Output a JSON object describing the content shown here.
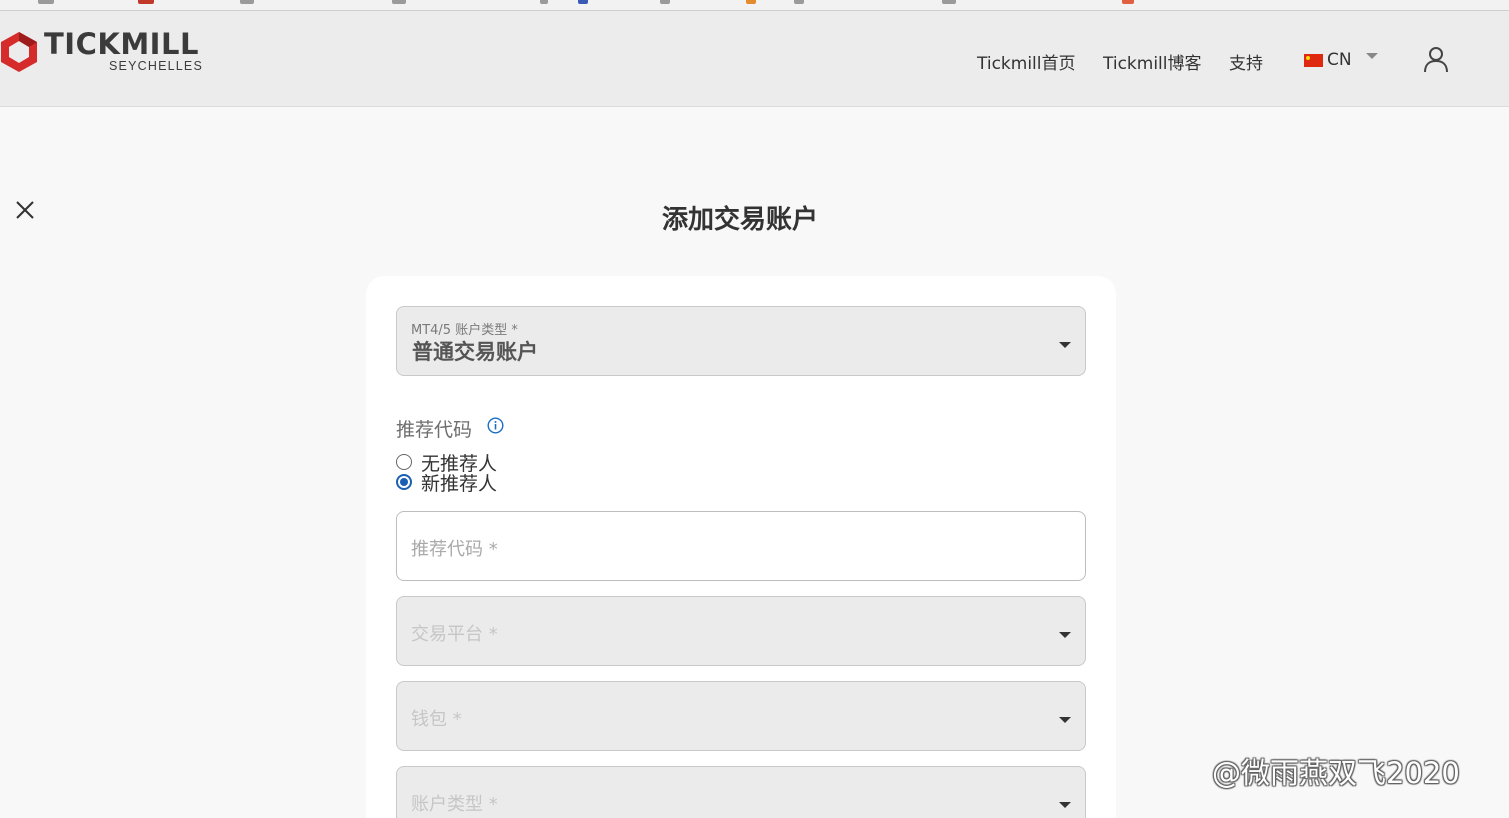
{
  "brand": {
    "name": "TICKMILL",
    "region": "SEYCHELLES",
    "color": "#d62b2b"
  },
  "nav": {
    "items": [
      {
        "label": "Tickmill首页"
      },
      {
        "label": "Tickmill博客"
      },
      {
        "label": "支持"
      }
    ],
    "language": {
      "label": "CN",
      "flag": "china-flag-icon"
    },
    "user_icon": "user-icon"
  },
  "dialog": {
    "title": "添加交易账户",
    "close_icon": "close-icon"
  },
  "form": {
    "account_type_field": {
      "label": "MT4/5 账户类型 *",
      "value": "普通交易账户"
    },
    "referral": {
      "label": "推荐代码",
      "options": [
        {
          "label": "无推荐人",
          "checked": false
        },
        {
          "label": "新推荐人",
          "checked": true
        }
      ]
    },
    "referral_code_input": {
      "placeholder": "推荐代码 *"
    },
    "platform_select": {
      "placeholder": "交易平台 *"
    },
    "wallet_select": {
      "placeholder": "钱包 *"
    },
    "account_kind_select": {
      "placeholder": "账户类型 *"
    }
  },
  "watermark": "@微雨燕双飞2020",
  "colors": {
    "accent": "#1a5fb4",
    "brand_red": "#d62b2b",
    "header_bg": "#ececec"
  }
}
